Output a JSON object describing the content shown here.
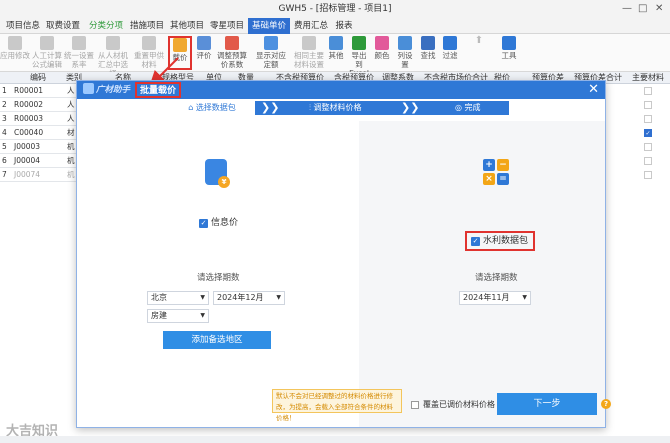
{
  "window": {
    "title": "GWH5 - [招标管理 - 项目1]"
  },
  "menu": {
    "tabs": [
      {
        "label": "项目信息"
      },
      {
        "label": "取费设置"
      },
      {
        "label": "分类分项"
      },
      {
        "label": "措施项目"
      },
      {
        "label": "其他项目"
      },
      {
        "label": "零星项目"
      },
      {
        "label": "基础单价"
      },
      {
        "label": "费用汇总"
      },
      {
        "label": "报表"
      }
    ]
  },
  "toolbar": {
    "items": [
      {
        "label": "应用修改"
      },
      {
        "label": "人工计算公式编辑"
      },
      {
        "label": "统一设置系率"
      },
      {
        "label": "从人材机汇总中选择"
      },
      {
        "label": "重置甲供材料"
      },
      {
        "label": "载价"
      },
      {
        "label": "评价"
      },
      {
        "label": "调整预算价系数"
      },
      {
        "label": "显示对应定额"
      },
      {
        "label": "相同主要材料设置"
      },
      {
        "label": "其他"
      },
      {
        "label": "导出到Excel"
      },
      {
        "label": "颜色"
      },
      {
        "label": "列设置"
      },
      {
        "label": "查找"
      },
      {
        "label": "过滤"
      },
      {
        "label": "工具"
      }
    ]
  },
  "grid": {
    "headers": [
      "编码",
      "类别",
      "名称",
      "规格型号",
      "单位",
      "数量",
      "不含税预算价",
      "含税预算价",
      "调整系数",
      "不含税市场价合计",
      "税价",
      "预算价差",
      "预算价差合计",
      "主要材料"
    ],
    "rows": [
      {
        "n": "1",
        "code": "R00001",
        "type": "人",
        "main": false
      },
      {
        "n": "2",
        "code": "R00002",
        "type": "人",
        "main": false
      },
      {
        "n": "3",
        "code": "R00003",
        "type": "人",
        "main": false
      },
      {
        "n": "4",
        "code": "C00040",
        "type": "材",
        "main": true
      },
      {
        "n": "5",
        "code": "J00003",
        "type": "机",
        "main": false
      },
      {
        "n": "6",
        "code": "J00004",
        "type": "机",
        "main": false
      },
      {
        "n": "7",
        "code": "J00074",
        "type": "机",
        "main": false
      }
    ]
  },
  "dialog": {
    "logo": "广材助手",
    "title": "批量载价",
    "steps": [
      {
        "label": "选择数据包"
      },
      {
        "label": "调整材料价格"
      },
      {
        "label": "完成"
      }
    ],
    "left": {
      "option_label": "信息价",
      "period_label": "请选择期数",
      "province": "北京",
      "period": "2024年12月",
      "category": "房建",
      "add_button": "添加备选地区"
    },
    "right": {
      "option_label": "水利数据包",
      "period_label": "请选择期数",
      "period": "2024年11月"
    },
    "tip_text": "默认不会对已经调整过的材料价格进行修改，为提高，会载入全部符合条件的材料价格！",
    "overwrite_label": "覆盖已调价材料价格",
    "next_button": "下一步",
    "help": "?"
  },
  "watermark": "大吉知识",
  "colors": {
    "primary": "#2f78d6",
    "highlight": "#e0332f"
  }
}
